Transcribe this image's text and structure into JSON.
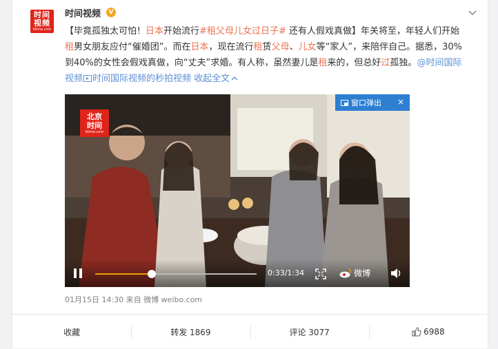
{
  "post": {
    "author": "时间视频",
    "avatar_text": "时间\n视频",
    "avatar_sub": "btime.com",
    "verified_mark": "V",
    "more_icon": "chevron-down-icon",
    "text": {
      "p1": "【毕竟孤独太可怕！",
      "p2": "日本",
      "p3": "开始流行",
      "p4": "#租父母儿女过日子#",
      "p5": " 还有人假戏真做】年关将至，年轻人们开始",
      "p6": "租",
      "p7": "男女朋友应付“催婚团”。而在",
      "p8": "日本",
      "p9": "，现在流行",
      "p10": "租",
      "p11": "赁",
      "p12": "父母",
      "p13": "、",
      "p14": "儿女",
      "p15": "等“家人”，来陪伴自己。据悉，30%到40%的女性会假戏真做，向“丈夫”求婚。有人称，虽然妻儿是",
      "p16": "租",
      "p17": "来的，但总好",
      "p18": "过",
      "p19": "孤独。",
      "link": "@时间国际视频",
      "link_icon": "video-icon",
      "link2": "时间国际视频的秒拍视频",
      "expand": "收起全文"
    },
    "video": {
      "popout_label": "窗口弹出",
      "close": "×",
      "logo_text": "北京\n时间",
      "logo_sub": "btime.com",
      "time": "0:33/1:34",
      "progress": 0.35,
      "weibo_label": "微博"
    },
    "meta": "01月15日 14:30 来自 微博 weibo.com",
    "actions": {
      "favorite": "收藏",
      "repost": "转发 1869",
      "comment": "评论 3077",
      "like": "6988"
    },
    "colors": {
      "highlight": "#eb7350",
      "brand_red": "#e0241a",
      "popout_blue": "#2d7fd1",
      "progress": "#f0a000"
    }
  }
}
